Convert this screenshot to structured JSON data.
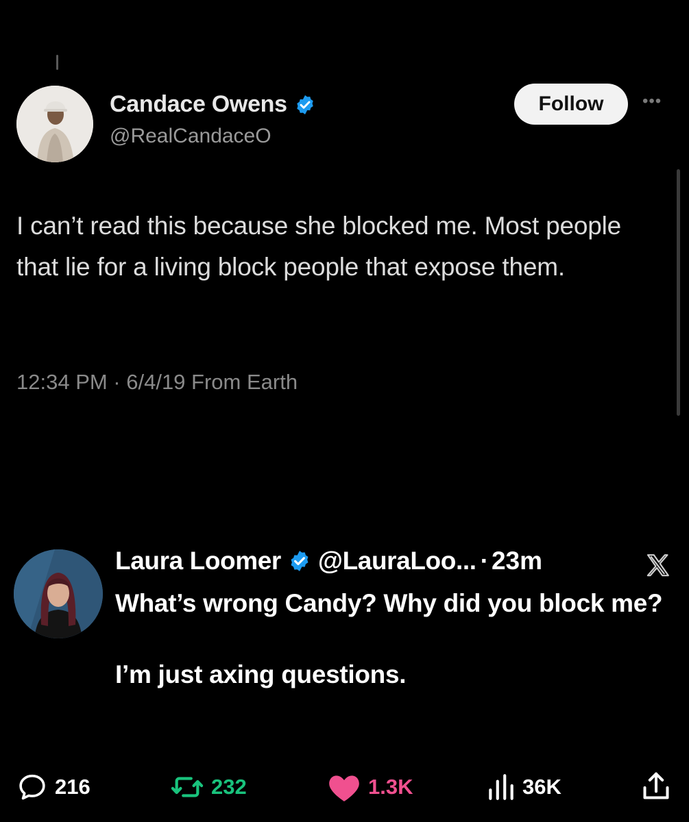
{
  "original_tweet": {
    "author_name": "Candace Owens",
    "handle": "@RealCandaceO",
    "follow_label": "Follow",
    "more_label": "•••",
    "text": "I can’t read this because she blocked me. Most people that lie for a living block people that expose them.",
    "meta": "12:34 PM · 6/4/19 From Earth"
  },
  "reply_tweet": {
    "author_name": "Laura Loomer",
    "handle": "@LauraLoo...",
    "separator": "·",
    "time": "23m",
    "text_line1": "What’s wrong Candy? Why did you block me?",
    "text_line2": "I’m just axing questions.",
    "platform_icon": "x-logo-icon"
  },
  "actions": {
    "replies": "216",
    "reposts": "232",
    "likes": "1.3K",
    "views": "36K"
  },
  "colors": {
    "background": "#000000",
    "verified": "#1d9bf0",
    "repost": "#19c37d",
    "like": "#f0508f",
    "follow_button_bg": "#f2f2f2"
  }
}
